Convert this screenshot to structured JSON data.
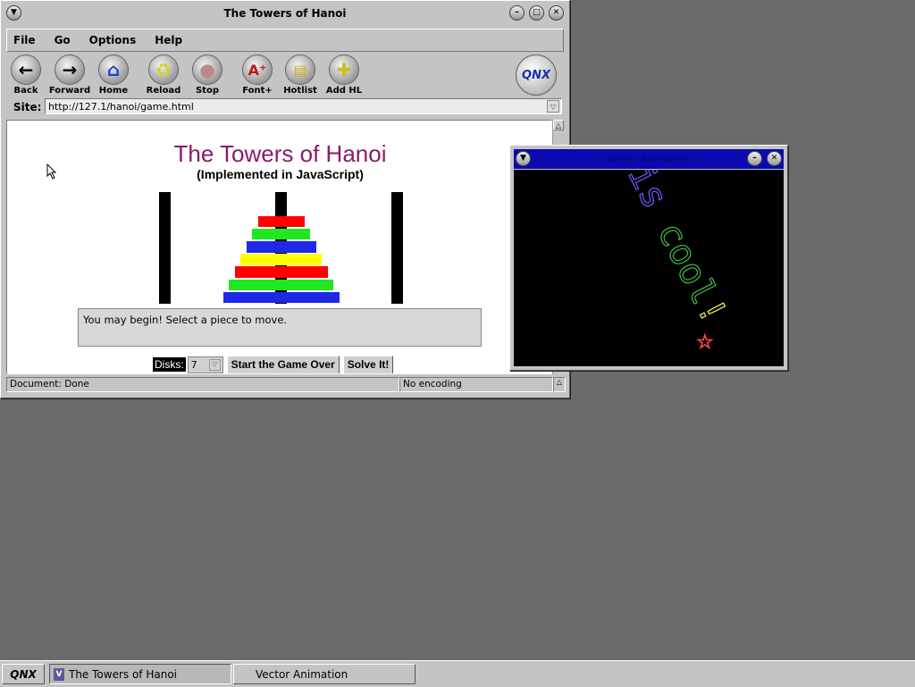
{
  "browser": {
    "title": "The Towers of Hanoi",
    "menu": [
      "File",
      "Go",
      "Options",
      "Help"
    ],
    "toolbar": [
      {
        "label": "Back",
        "icon": "back-arrow-icon"
      },
      {
        "label": "Forward",
        "icon": "forward-arrow-icon"
      },
      {
        "label": "Home",
        "icon": "home-icon"
      },
      {
        "label": "Reload",
        "icon": "reload-icon"
      },
      {
        "label": "Stop",
        "icon": "stop-icon"
      },
      {
        "label": "Font+",
        "icon": "font-plus-icon"
      },
      {
        "label": "Hotlist",
        "icon": "hotlist-icon"
      },
      {
        "label": "Add HL",
        "icon": "add-hotlist-icon"
      }
    ],
    "logo": "QNX",
    "site_label": "Site:",
    "url": "http://127.1/hanoi/game.html",
    "status": {
      "left": "Document: Done",
      "right": "No encoding"
    }
  },
  "page": {
    "title": "The Towers of Hanoi",
    "subtitle": "(Implemented in JavaScript)",
    "message": "You may begin! Select a piece to move.",
    "disks_label": "Disks:",
    "disks_value": "7",
    "start_over_label": "Start the Game Over",
    "solve_label": "Solve It!",
    "disk_colors": [
      "#ff0000",
      "#22e622",
      "#1e28e6",
      "#ffff00",
      "#ff0000",
      "#22e622",
      "#1e28e6"
    ]
  },
  "vector_window": {
    "title": "Vector Animation",
    "animated_text": "QNX is cool!",
    "colors": [
      "#cc44cc",
      "#6a5cff",
      "#44bb44",
      "#ffee66",
      "#ff4444"
    ]
  },
  "taskbar": {
    "start": "QNX",
    "tasks": [
      "The Towers of Hanoi",
      "Vector Animation"
    ]
  }
}
